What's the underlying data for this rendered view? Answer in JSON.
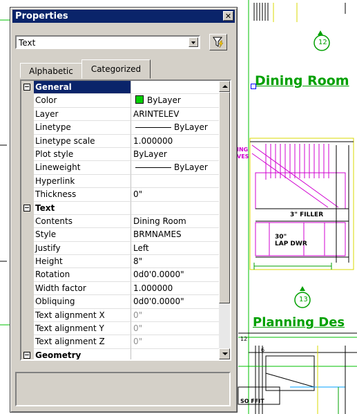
{
  "palette": {
    "title": "Properties",
    "object_type_selected": "Text",
    "tabs": [
      {
        "label": "Alphabetic",
        "active": false
      },
      {
        "label": "Categorized",
        "active": true
      }
    ],
    "categories": {
      "general": "General",
      "text": "Text",
      "geometry": "Geometry"
    },
    "rows": {
      "general": [
        {
          "name": "Color",
          "value": "ByLayer"
        },
        {
          "name": "Layer",
          "value": "ARINTELEV"
        },
        {
          "name": "Linetype",
          "value": "ByLayer"
        },
        {
          "name": "Linetype scale",
          "value": "1.000000"
        },
        {
          "name": "Plot style",
          "value": "ByLayer"
        },
        {
          "name": "Lineweight",
          "value": "ByLayer"
        },
        {
          "name": "Hyperlink",
          "value": ""
        },
        {
          "name": "Thickness",
          "value": "0\""
        }
      ],
      "text": [
        {
          "name": "Contents",
          "value": "Dining Room"
        },
        {
          "name": "Style",
          "value": "BRMNAMES"
        },
        {
          "name": "Justify",
          "value": "Left"
        },
        {
          "name": "Height",
          "value": "8\""
        },
        {
          "name": "Rotation",
          "value": "0d0'0.0000\""
        },
        {
          "name": "Width factor",
          "value": "1.000000"
        },
        {
          "name": "Obliquing",
          "value": "0d0'0.0000\""
        },
        {
          "name": "Text alignment X",
          "value": "0\""
        },
        {
          "name": "Text alignment Y",
          "value": "0\""
        },
        {
          "name": "Text alignment Z",
          "value": "0\""
        }
      ]
    },
    "colors": {
      "color_swatch": "#00d000",
      "title_bar": "#0a246a"
    }
  },
  "drawing": {
    "dining_room_label": "Dining Room",
    "planning_label": "Planning Des",
    "bubble_12": "12",
    "bubble_13": "13",
    "filler_note": "3\" FILLER",
    "drawer_note_1": "30\"",
    "drawer_note_2": "LAP DWR",
    "soffit_note": "SO FFIT",
    "dim_12": "12",
    "dim_6": "6",
    "left_note_1": "ING",
    "left_note_2": "VES",
    "colors": {
      "accent_green": "#00a000",
      "magenta": "#d000d0",
      "yellow": "#d8d800"
    }
  }
}
